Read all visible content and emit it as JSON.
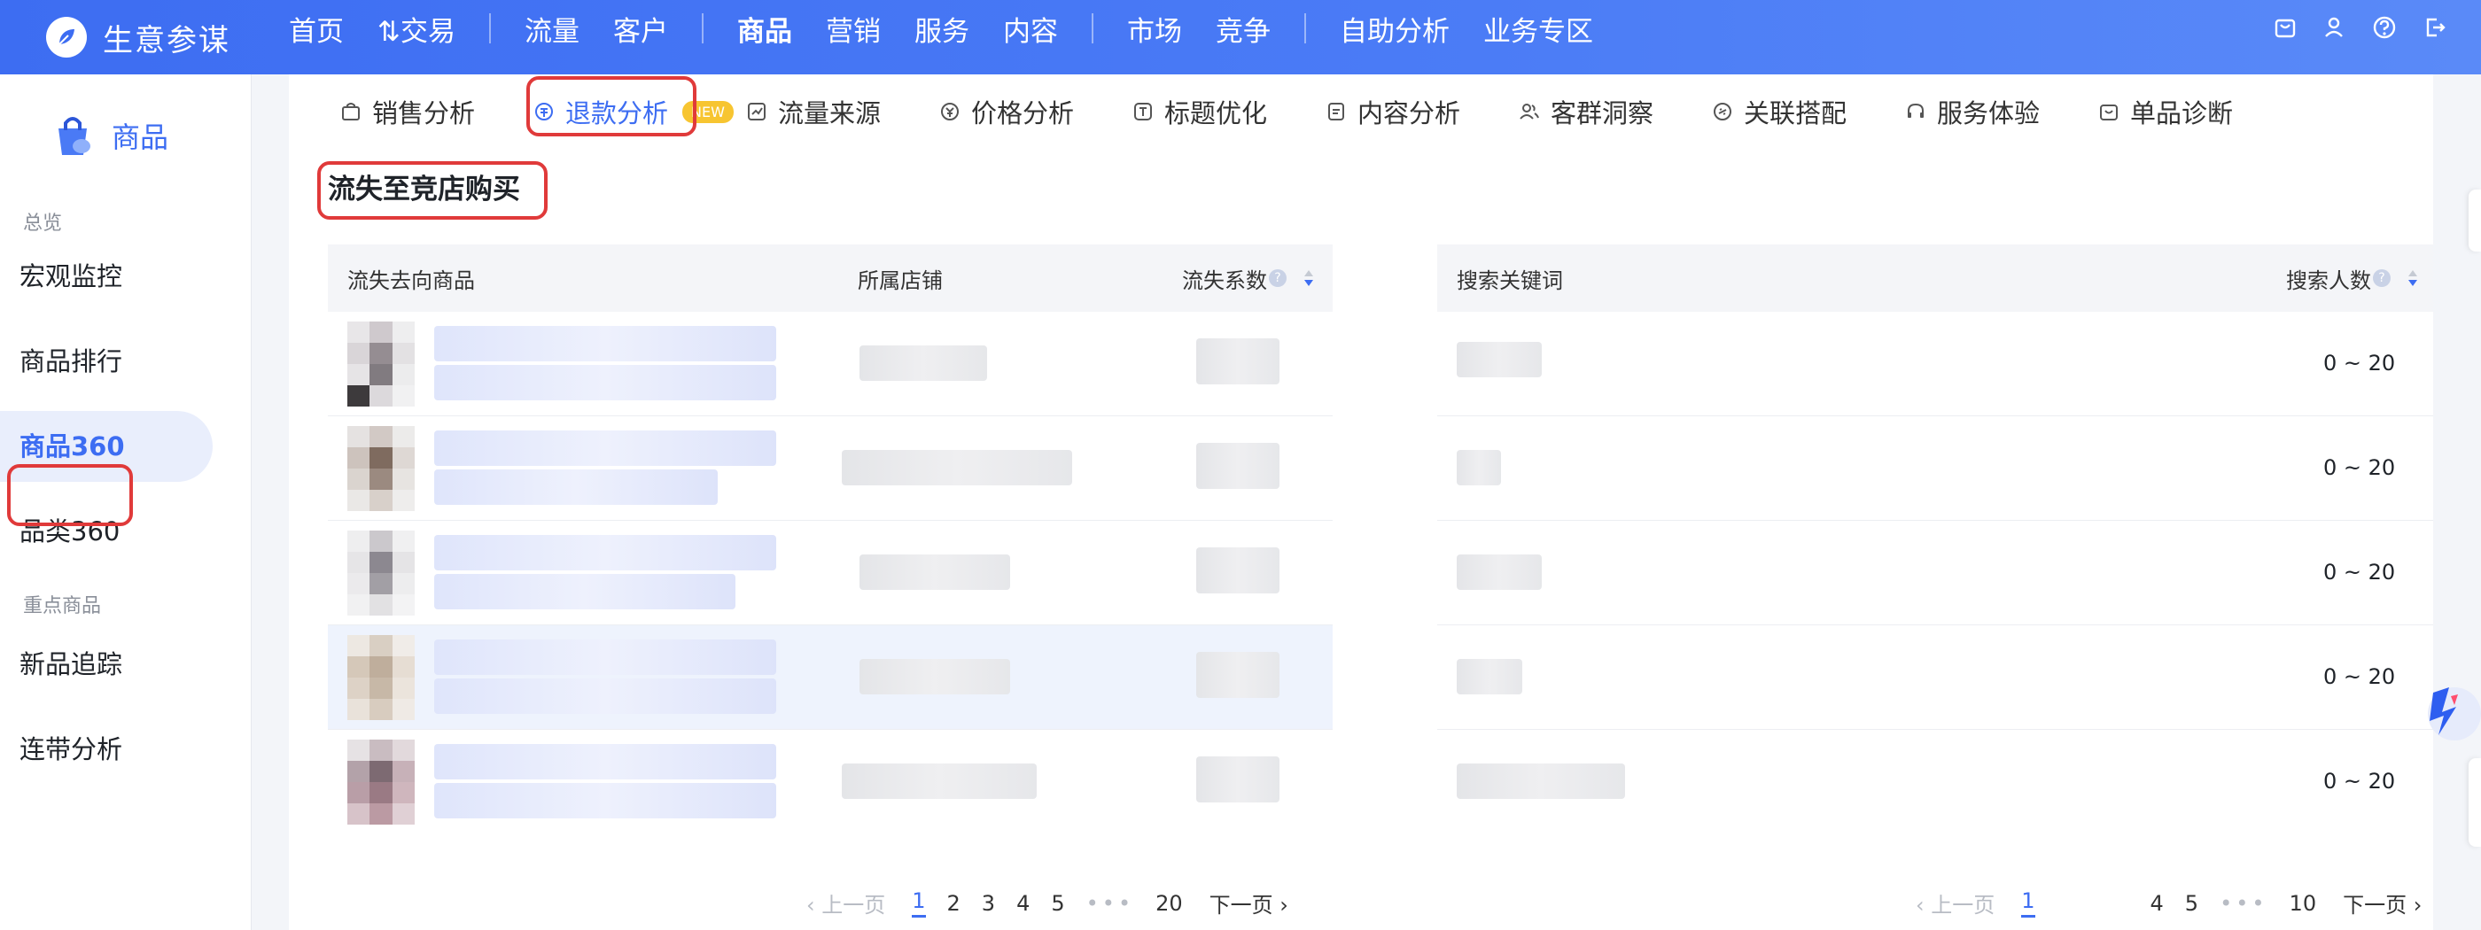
{
  "app": {
    "name": "生意参谋"
  },
  "nav": {
    "items": [
      {
        "label": "首页"
      },
      {
        "label": "⇅交易"
      },
      {
        "label": "流量"
      },
      {
        "label": "客户"
      },
      {
        "label": "商品",
        "active": true
      },
      {
        "label": "营销"
      },
      {
        "label": "服务"
      },
      {
        "label": "内容"
      },
      {
        "label": "市场"
      },
      {
        "label": "竞争"
      },
      {
        "label": "自助分析"
      },
      {
        "label": "业务专区"
      }
    ],
    "icons": [
      "bag-icon",
      "user-icon",
      "help-icon",
      "logout-icon"
    ]
  },
  "sidebar": {
    "header": "商品",
    "groups": [
      {
        "title": "总览",
        "items": [
          "宏观监控",
          "商品排行",
          "商品360",
          "品类360"
        ]
      },
      {
        "title": "重点商品",
        "items": [
          "新品追踪",
          "连带分析"
        ]
      }
    ],
    "active_item": "商品360"
  },
  "subtabs": {
    "items": [
      {
        "label": "销售分析",
        "icon": "bag-icon"
      },
      {
        "label": "退款分析",
        "icon": "refund-icon",
        "active": true
      },
      {
        "label": "流量来源",
        "icon": "trend-icon",
        "badge": "NEW"
      },
      {
        "label": "价格分析",
        "icon": "price-icon"
      },
      {
        "label": "标题优化",
        "icon": "title-icon"
      },
      {
        "label": "内容分析",
        "icon": "doc-icon"
      },
      {
        "label": "客群洞察",
        "icon": "users-icon"
      },
      {
        "label": "关联搭配",
        "icon": "link-icon"
      },
      {
        "label": "服务体验",
        "icon": "headset-icon"
      },
      {
        "label": "单品诊断",
        "icon": "diagnose-icon"
      }
    ]
  },
  "section": {
    "title": "流失至竞店购买"
  },
  "left_table": {
    "headers": {
      "product": "流失去向商品",
      "shop": "所属店铺",
      "coef": "流失系数"
    },
    "row_count": 5
  },
  "right_table": {
    "headers": {
      "keyword": "搜索关键词",
      "count": "搜索人数"
    },
    "rows": [
      {
        "count": "0 ~ 20"
      },
      {
        "count": "0 ~ 20"
      },
      {
        "count": "0 ~ 20"
      },
      {
        "count": "0 ~ 20"
      },
      {
        "count": "0 ~ 20"
      }
    ]
  },
  "pager_left": {
    "prev": "上一页",
    "pages": [
      "1",
      "2",
      "3",
      "4",
      "5"
    ],
    "ellipsis": "•••",
    "last": "20",
    "next": "下一页",
    "current": "1"
  },
  "pager_right": {
    "prev": "上一页",
    "pages": [
      "1",
      "",
      "",
      "4",
      "5"
    ],
    "ellipsis": "•••",
    "last": "10",
    "next": "下一页",
    "current": "1"
  },
  "colors": {
    "brand": "#3d6df2",
    "highlight_box": "#e03a3a",
    "badge": "#f7c531"
  }
}
